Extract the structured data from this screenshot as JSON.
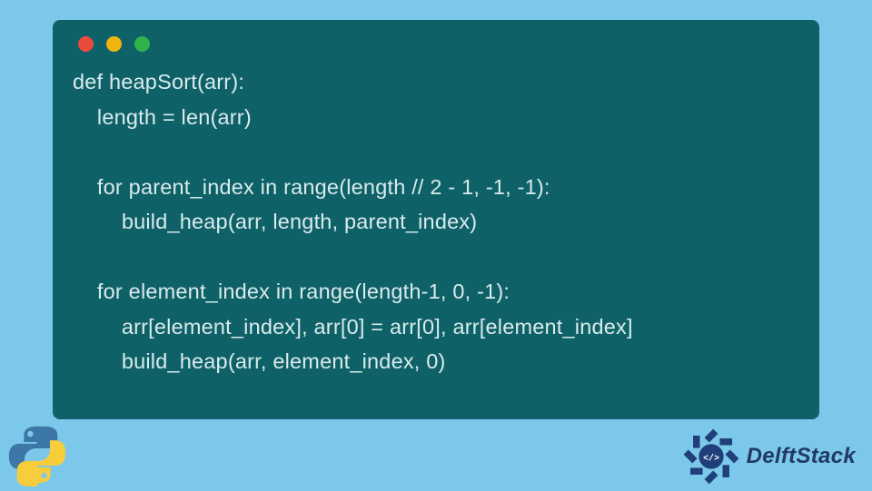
{
  "code": {
    "language": "python",
    "lines": [
      "def heapSort(arr):",
      "    length = len(arr)",
      "",
      "    for parent_index in range(length // 2 - 1, -1, -1):",
      "        build_heap(arr, length, parent_index)",
      "",
      "    for element_index in range(length-1, 0, -1):",
      "        arr[element_index], arr[0] = arr[0], arr[element_index]",
      "        build_heap(arr, element_index, 0)"
    ]
  },
  "window": {
    "traffic_lights": [
      "red",
      "yellow",
      "green"
    ]
  },
  "branding": {
    "site_name": "DelftStack",
    "language_icon": "python-logo",
    "site_icon": "delftstack-emblem"
  },
  "colors": {
    "page_bg": "#7cc8eb",
    "window_bg": "#0f6168",
    "code_text": "#d9ebec",
    "brand_text": "#213a63"
  }
}
